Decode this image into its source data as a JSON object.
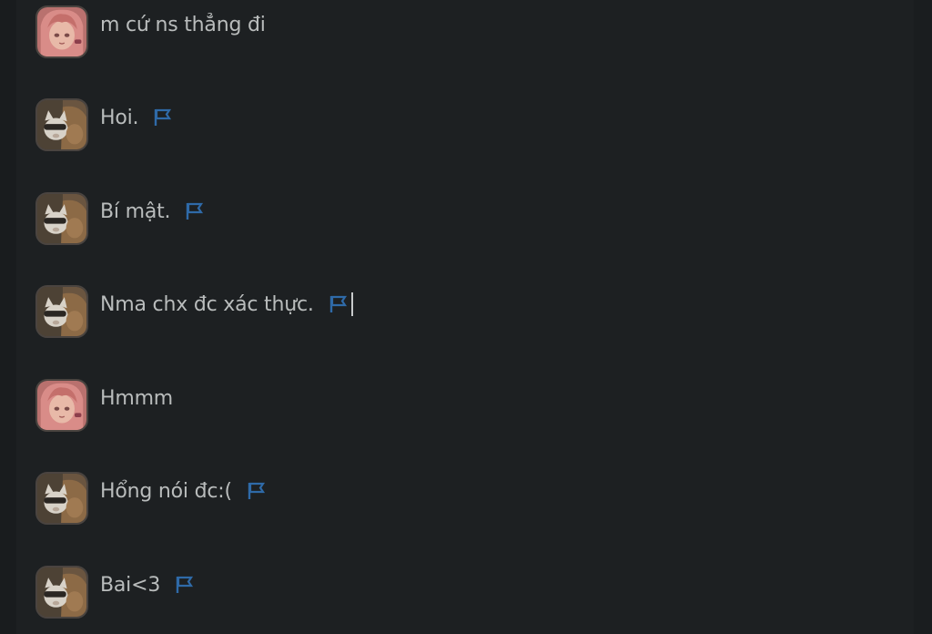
{
  "messages": [
    {
      "avatar": "pink-hair-girl-avatar",
      "text": "m cứ ns thẳng đi",
      "flag": false
    },
    {
      "avatar": "cat-avatar",
      "text": "Hoi.",
      "flag": true
    },
    {
      "avatar": "cat-avatar",
      "text": "Bí mật.",
      "flag": true
    },
    {
      "avatar": "cat-avatar",
      "text": "Nma chx đc xác thực.",
      "flag": true,
      "caret": true
    },
    {
      "avatar": "pink-hair-girl-avatar",
      "text": "Hmmm",
      "flag": false
    },
    {
      "avatar": "cat-avatar",
      "text": "Hổng nói đc:(",
      "flag": true
    },
    {
      "avatar": "cat-avatar",
      "text": "Bai<3",
      "flag": true
    }
  ],
  "colors": {
    "background": "#1d2022",
    "text": "#b9bcbc",
    "flag": "#2f6aa8"
  },
  "icons": {
    "flag": "flag-icon"
  }
}
